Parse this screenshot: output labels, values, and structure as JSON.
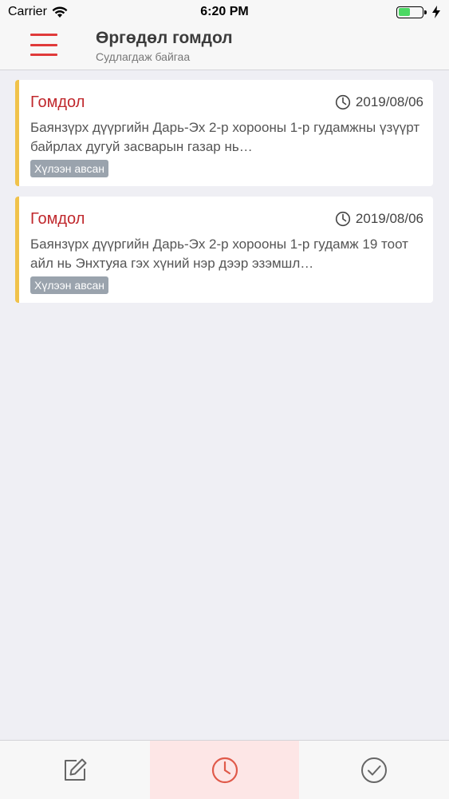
{
  "status_bar": {
    "carrier": "Carrier",
    "time": "6:20 PM"
  },
  "header": {
    "title": "Өргөдөл гомдол",
    "subtitle": "Судлагдаж байгаа"
  },
  "items": [
    {
      "type": "Гомдол",
      "date": "2019/08/06",
      "text": "Баянзүрх дүүргийн Дарь-Эх 2-р хорооны 1-р гудамжны үзүүрт байрлах дугуй засварын газар нь…",
      "status": "Хүлээн авсан"
    },
    {
      "type": "Гомдол",
      "date": "2019/08/06",
      "text": "Баянзүрх дүүргийн Дарь-Эх 2-р хорооны 1-р гудамж 19 тоот айл нь Энхтуяа гэх хүний нэр дээр  эзэмшл…",
      "status": "Хүлээн авсан"
    }
  ],
  "tabs": [
    {
      "icon": "edit-icon",
      "active": false
    },
    {
      "icon": "clock-icon",
      "active": true
    },
    {
      "icon": "check-circle-icon",
      "active": false
    }
  ],
  "colors": {
    "accent": "#e03a3a",
    "card_border": "#f0c24a",
    "type_text": "#c0282d",
    "badge": "#9aa3ad",
    "active_tab_bg": "#fde6e6"
  }
}
